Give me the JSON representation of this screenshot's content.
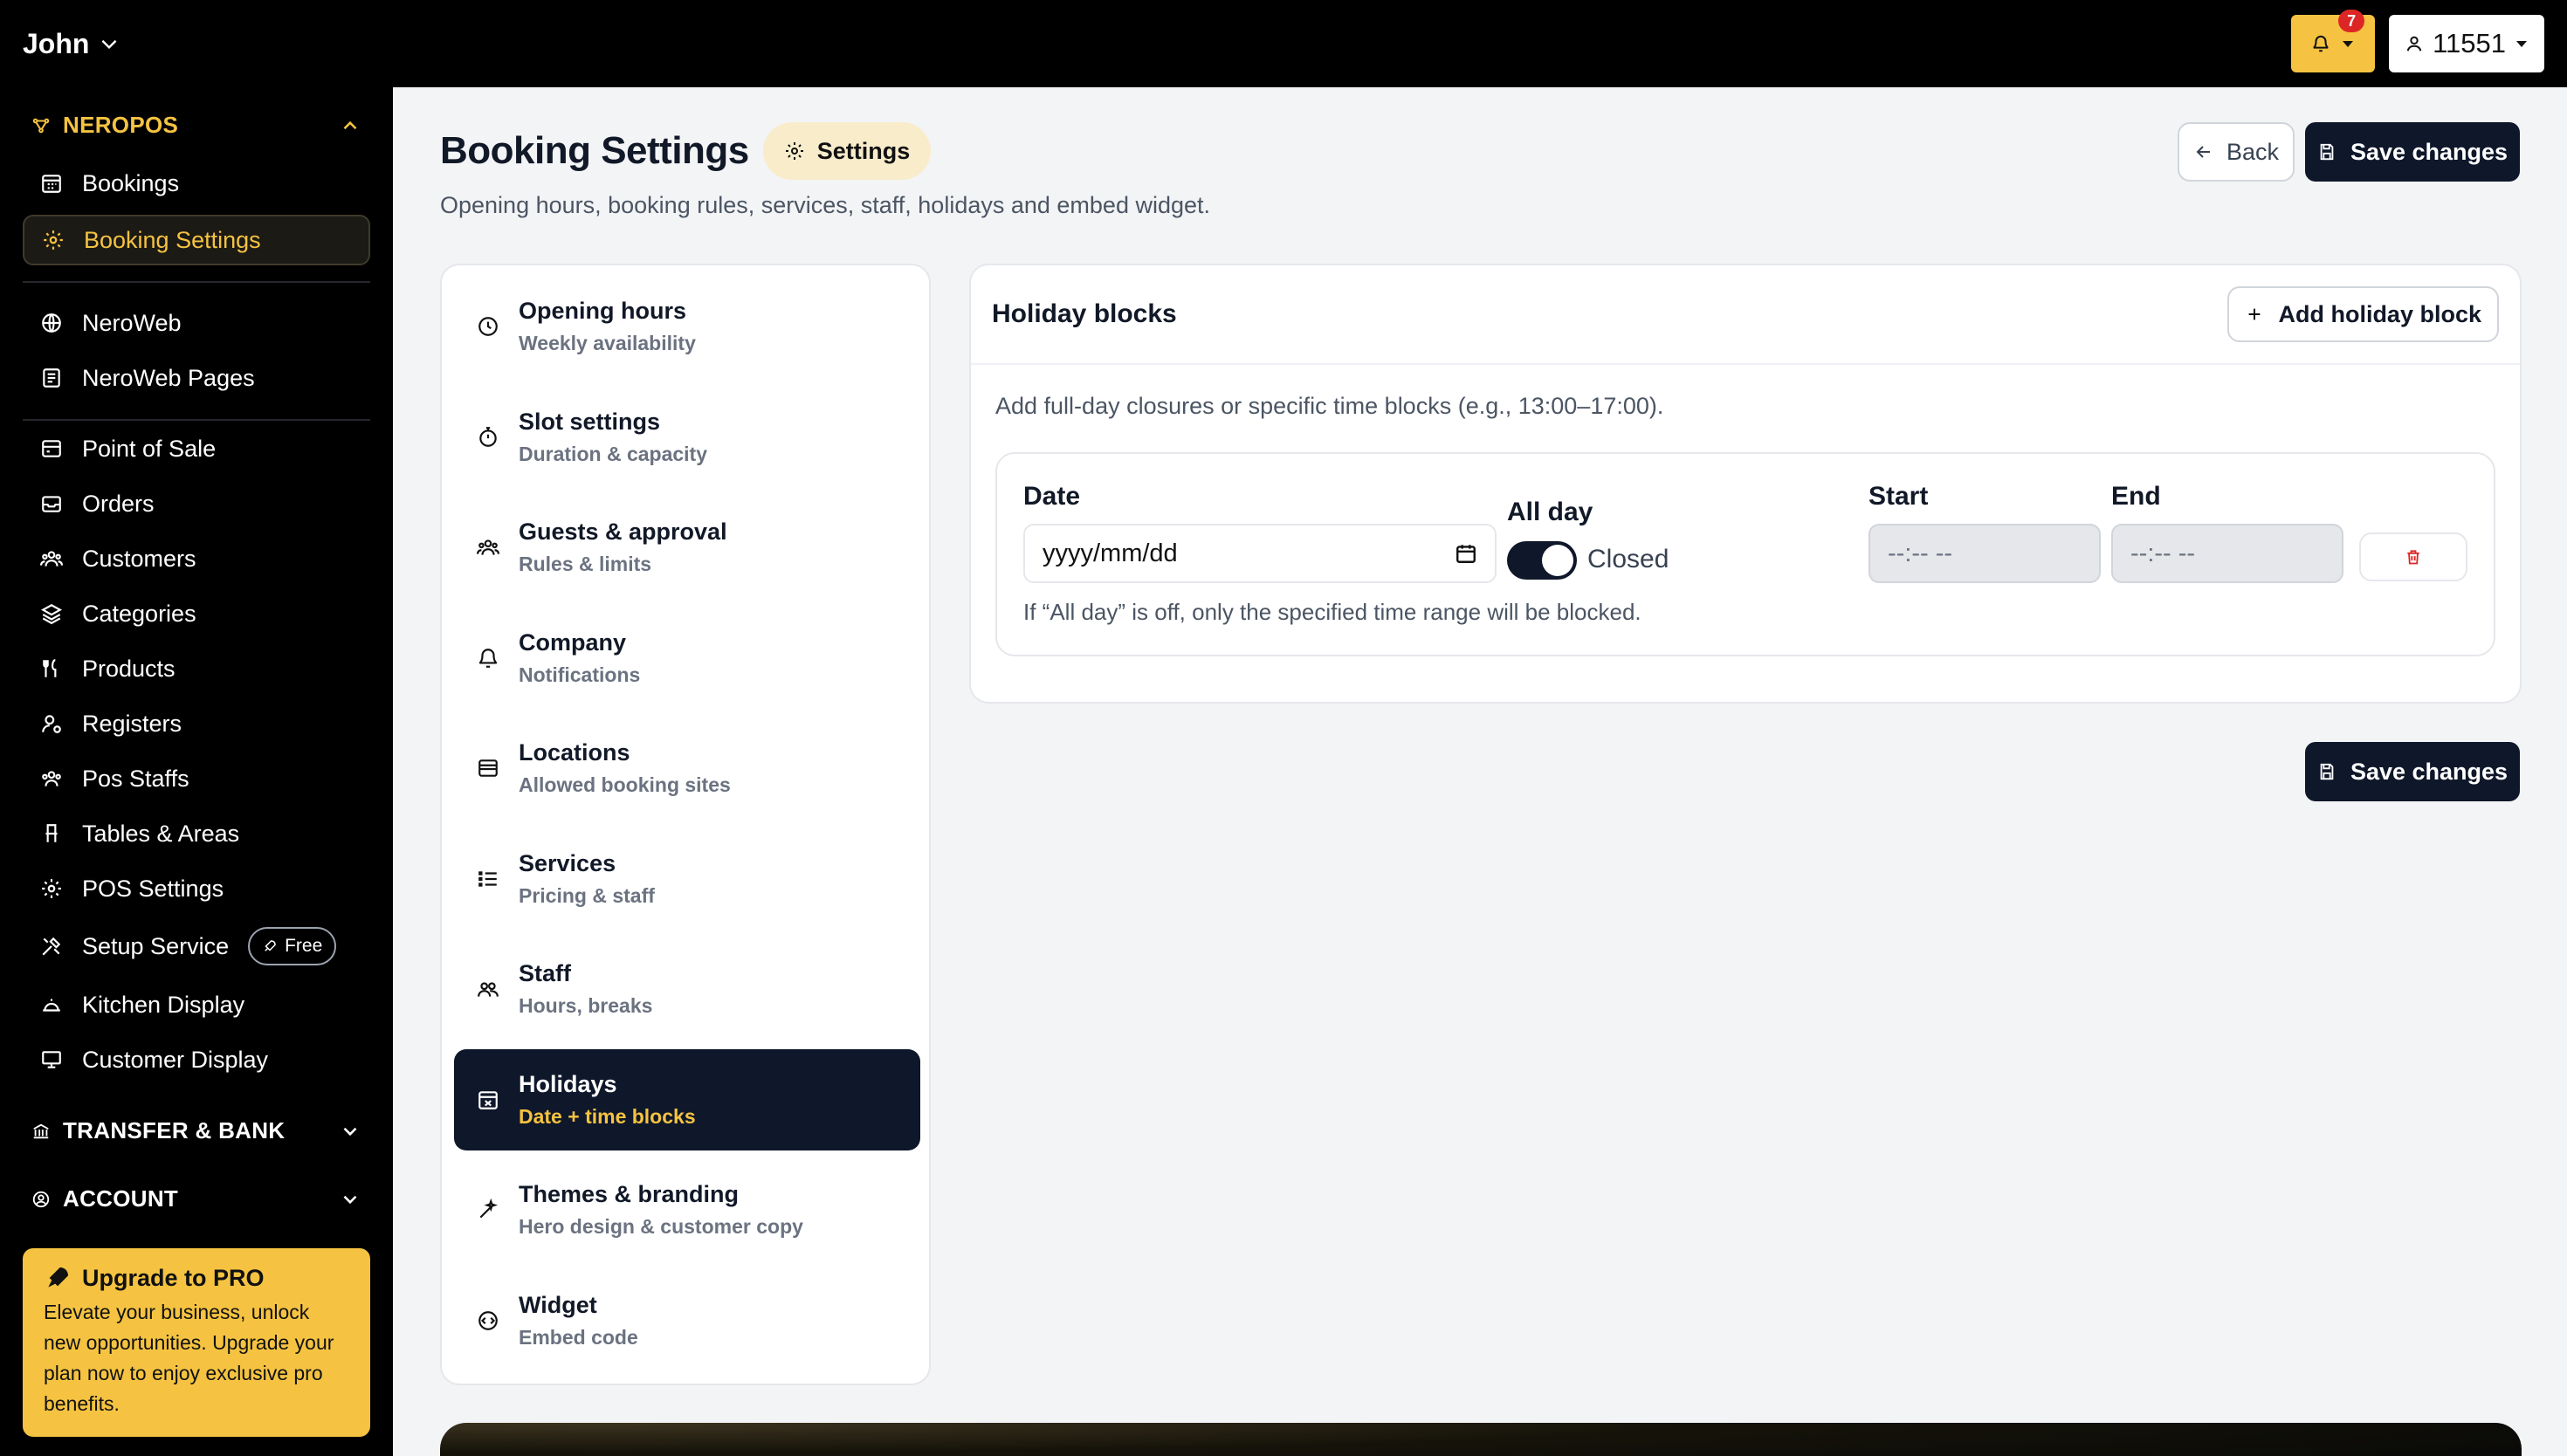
{
  "topbar": {
    "user_name": "John",
    "notification_count": "7",
    "account_id": "11551"
  },
  "sidebar": {
    "neropos_title": "NEROPOS",
    "items": [
      {
        "label": "Bookings"
      },
      {
        "label": "Booking Settings"
      },
      {
        "label": "NeroWeb"
      },
      {
        "label": "NeroWeb Pages"
      },
      {
        "label": "Point of Sale"
      },
      {
        "label": "Orders"
      },
      {
        "label": "Customers"
      },
      {
        "label": "Categories"
      },
      {
        "label": "Products"
      },
      {
        "label": "Registers"
      },
      {
        "label": "Pos Staffs"
      },
      {
        "label": "Tables & Areas"
      },
      {
        "label": "POS Settings"
      },
      {
        "label": "Setup Service"
      },
      {
        "label": "Kitchen Display"
      },
      {
        "label": "Customer Display"
      }
    ],
    "free_badge": "Free",
    "transfer_title": "TRANSFER & BANK",
    "account_title": "ACCOUNT",
    "upgrade": {
      "title": "Upgrade to PRO",
      "description": "Elevate your business, unlock new opportunities. Upgrade your plan now to enjoy exclusive pro benefits."
    }
  },
  "header": {
    "title": "Booking Settings",
    "pill": "Settings",
    "subtitle": "Opening hours, booking rules, services, staff, holidays and embed widget.",
    "back_label": "Back",
    "save_label": "Save changes"
  },
  "settings_nav": [
    {
      "title": "Opening hours",
      "subtitle": "Weekly availability"
    },
    {
      "title": "Slot settings",
      "subtitle": "Duration & capacity"
    },
    {
      "title": "Guests & approval",
      "subtitle": "Rules & limits"
    },
    {
      "title": "Company",
      "subtitle": "Notifications"
    },
    {
      "title": "Locations",
      "subtitle": "Allowed booking sites"
    },
    {
      "title": "Services",
      "subtitle": "Pricing & staff"
    },
    {
      "title": "Staff",
      "subtitle": "Hours, breaks"
    },
    {
      "title": "Holidays",
      "subtitle": "Date + time blocks"
    },
    {
      "title": "Themes & branding",
      "subtitle": "Hero design & customer copy"
    },
    {
      "title": "Widget",
      "subtitle": "Embed code"
    }
  ],
  "holiday": {
    "title": "Holiday blocks",
    "add_label": "Add holiday block",
    "description": "Add full-day closures or specific time blocks (e.g., 13:00–17:00).",
    "date_label": "Date",
    "date_placeholder": "yyyy/mm/dd",
    "allday_label": "All day",
    "allday_state": "Closed",
    "start_label": "Start",
    "end_label": "End",
    "start_placeholder": "--:-- --",
    "end_placeholder": "--:-- --",
    "hint": "If “All day” is off, only the specified time range will be blocked."
  },
  "colors": {
    "accent": "#f5c341",
    "primary": "#0f172a",
    "danger": "#dc2626"
  }
}
